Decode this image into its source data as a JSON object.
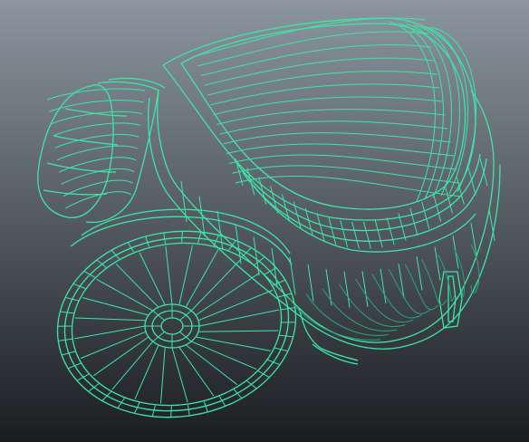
{
  "viewport": {
    "background_top": "#8c96a0",
    "background_bottom": "#1a1d20"
  },
  "model": {
    "name": "canister-vacuum-wireframe",
    "wire_color": "#3ee6a6",
    "wire_color_dim": "#2aa67a",
    "wire_color_bright": "#5dffc0"
  }
}
